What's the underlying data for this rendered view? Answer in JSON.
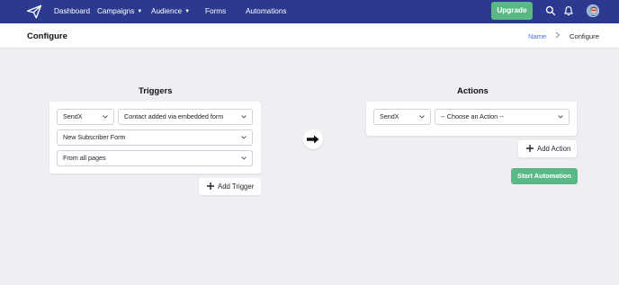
{
  "nav": {
    "dashboard": "Dashboard",
    "campaigns": "Campaigns",
    "audience": "Audience",
    "forms": "Forms",
    "automations": "Automations",
    "upgrade": "Upgrade",
    "icons": [
      "paper-plane-logo-icon",
      "search-icon",
      "bell-icon",
      "avatar"
    ]
  },
  "header": {
    "title": "Configure",
    "breadcrumb": {
      "name": "Name",
      "separator": ">",
      "current": "Configure"
    }
  },
  "triggers": {
    "title": "Triggers",
    "provider": "SendX",
    "event": "Contact added via embedded form",
    "form": "New Subscriber Form",
    "pages": "From all pages",
    "add_label": "Add Trigger"
  },
  "actions": {
    "title": "Actions",
    "provider": "SendX",
    "action": "-- Choose an Action --",
    "add_label": "Add Action",
    "start_label": "Start Automation"
  },
  "colors": {
    "nav_bg": "#2b3a8f",
    "accent_green": "#5bb988",
    "link_blue": "#4a6fd6",
    "page_bg": "#efeff3"
  }
}
